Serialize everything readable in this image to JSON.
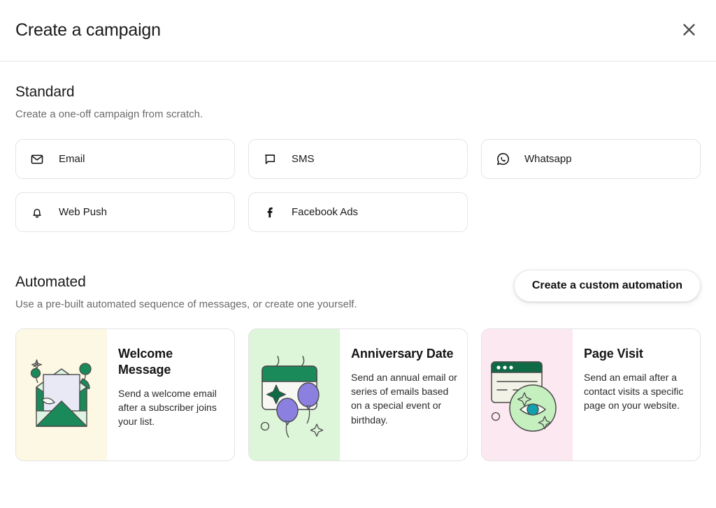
{
  "header": {
    "title": "Create a campaign",
    "close_icon": "close-icon"
  },
  "standard": {
    "title": "Standard",
    "subtitle": "Create a one-off campaign from scratch.",
    "channels": [
      {
        "label": "Email",
        "icon": "envelope-icon"
      },
      {
        "label": "SMS",
        "icon": "chat-bubble-icon"
      },
      {
        "label": "Whatsapp",
        "icon": "whatsapp-icon"
      },
      {
        "label": "Web Push",
        "icon": "bell-icon"
      },
      {
        "label": "Facebook Ads",
        "icon": "facebook-icon"
      }
    ]
  },
  "automated": {
    "title": "Automated",
    "subtitle": "Use a pre-built automated sequence of messages, or create one yourself.",
    "custom_button_label": "Create a custom automation",
    "cards": [
      {
        "title": "Welcome Message",
        "description": "Send a welcome email after a subscriber joins your list.",
        "art_bg": "#fdf8e3",
        "art_name": "envelope-illustration"
      },
      {
        "title": "Anniversary Date",
        "description": "Send an annual email or series of emails based on a special event or birthday.",
        "art_bg": "#ddf5d9",
        "art_name": "calendar-balloons-illustration"
      },
      {
        "title": "Page Visit",
        "description": "Send an email after a contact visits a specific page on your website.",
        "art_bg": "#fce8f0",
        "art_name": "browser-eye-illustration"
      }
    ]
  },
  "colors": {
    "green_dark": "#1b8a5a",
    "green_light": "#d9f2de",
    "purple": "#8b80e0",
    "teal": "#13a0ad",
    "border": "#e4e4e4",
    "text_muted": "#6b6b6b"
  }
}
